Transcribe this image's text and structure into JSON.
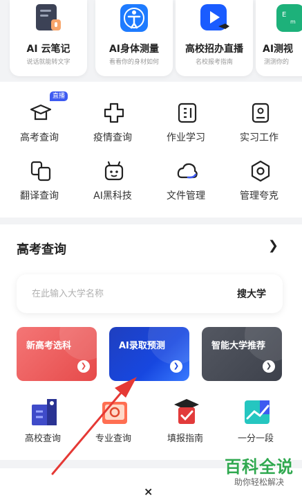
{
  "features": [
    {
      "title": "AI 云笔记",
      "subtitle": "说话就能转文字"
    },
    {
      "title": "AI身体测量",
      "subtitle": "看看你的身材如何"
    },
    {
      "title": "高校招办直播",
      "subtitle": "名校报考指南"
    },
    {
      "title": "AI测视",
      "subtitle": "测测你的"
    }
  ],
  "grid": [
    {
      "label": "高考查询",
      "badge": "直播"
    },
    {
      "label": "疫情查询"
    },
    {
      "label": "作业学习"
    },
    {
      "label": "实习工作"
    },
    {
      "label": "翻译查询"
    },
    {
      "label": "AI黑科技"
    },
    {
      "label": "文件管理"
    },
    {
      "label": "管理夸克"
    }
  ],
  "gaokao": {
    "title": "高考查询",
    "more": "❯",
    "search_placeholder": "在此输入大学名称",
    "search_button": "搜大学",
    "promos": [
      {
        "title": "新高考选科"
      },
      {
        "title": "AI录取预测"
      },
      {
        "title": "智能大学推荐"
      }
    ],
    "shortcuts": [
      {
        "label": "高校查询"
      },
      {
        "label": "专业查询"
      },
      {
        "label": "填报指南"
      },
      {
        "label": "一分一段"
      }
    ]
  },
  "close": "×",
  "watermark": {
    "main": "百科全说",
    "sub": "助你轻松解决"
  },
  "colors": {
    "accent": "#3d5af1",
    "annotation": "#e53935",
    "watermark": "#2fa84f"
  }
}
